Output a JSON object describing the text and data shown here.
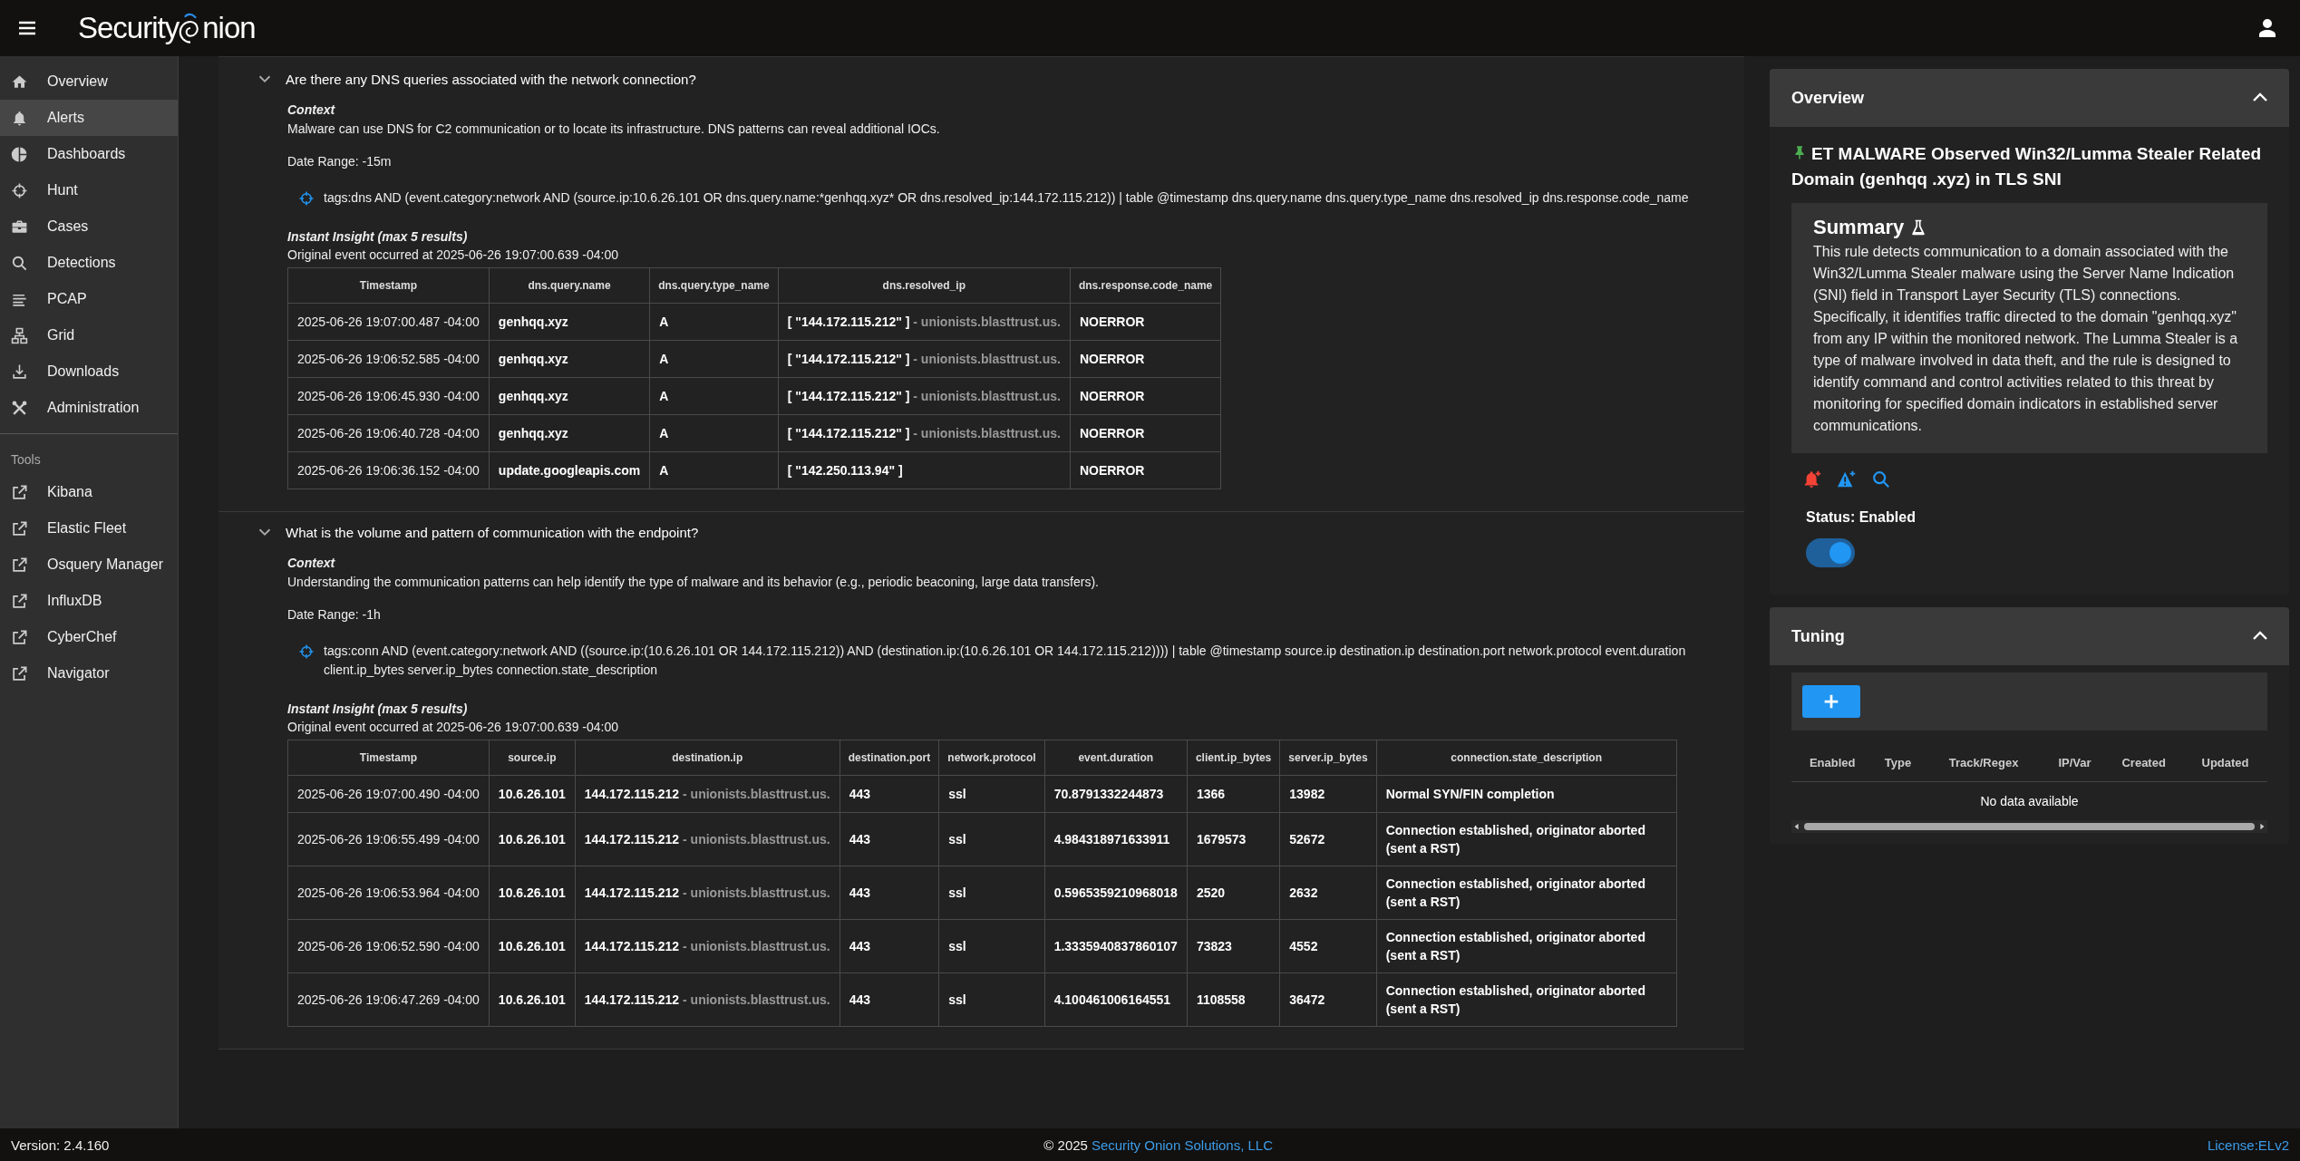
{
  "header": {
    "logo_prefix": "Security",
    "logo_suffix": "nion"
  },
  "sidebar": {
    "items": [
      {
        "label": "Overview",
        "selected": false
      },
      {
        "label": "Alerts",
        "selected": true
      },
      {
        "label": "Dashboards",
        "selected": false
      },
      {
        "label": "Hunt",
        "selected": false
      },
      {
        "label": "Cases",
        "selected": false
      },
      {
        "label": "Detections",
        "selected": false
      },
      {
        "label": "PCAP",
        "selected": false
      },
      {
        "label": "Grid",
        "selected": false
      },
      {
        "label": "Downloads",
        "selected": false
      },
      {
        "label": "Administration",
        "selected": false
      }
    ],
    "tools_heading": "Tools",
    "tools": [
      {
        "label": "Kibana"
      },
      {
        "label": "Elastic Fleet"
      },
      {
        "label": "Osquery Manager"
      },
      {
        "label": "InfluxDB"
      },
      {
        "label": "CyberChef"
      },
      {
        "label": "Navigator"
      }
    ]
  },
  "questions": [
    {
      "question": "Are there any DNS queries associated with the network connection?",
      "expanded": true,
      "context_heading": "Context",
      "context": "Malware can use DNS for C2 communication or to locate its infrastructure. DNS patterns can reveal additional IOCs.",
      "date_range": "Date Range: -15m",
      "query": "tags:dns AND (event.category:network AND (source.ip:10.6.26.101 OR dns.query.name:*genhqq.xyz* OR dns.resolved_ip:144.172.115.212)) | table @timestamp dns.query.name dns.query.type_name dns.resolved_ip dns.response.code_name",
      "insight_heading": "Instant Insight (max 5 results)",
      "original_event": "Original event occurred at 2025-06-26 19:07:00.639 -04:00",
      "table": {
        "columns": [
          "Timestamp",
          "dns.query.name",
          "dns.query.type_name",
          "dns.resolved_ip",
          "dns.response.code_name"
        ],
        "rows": [
          [
            "2025-06-26 19:07:00.487 -04:00",
            "genhqq.xyz",
            "A",
            {
              "text": "[ \"144.172.115.212\" ]",
              "host": "- unionists.blasttrust.us."
            },
            "NOERROR"
          ],
          [
            "2025-06-26 19:06:52.585 -04:00",
            "genhqq.xyz",
            "A",
            {
              "text": "[ \"144.172.115.212\" ]",
              "host": "- unionists.blasttrust.us."
            },
            "NOERROR"
          ],
          [
            "2025-06-26 19:06:45.930 -04:00",
            "genhqq.xyz",
            "A",
            {
              "text": "[ \"144.172.115.212\" ]",
              "host": "- unionists.blasttrust.us."
            },
            "NOERROR"
          ],
          [
            "2025-06-26 19:06:40.728 -04:00",
            "genhqq.xyz",
            "A",
            {
              "text": "[ \"144.172.115.212\" ]",
              "host": "- unionists.blasttrust.us."
            },
            "NOERROR"
          ],
          [
            "2025-06-26 19:06:36.152 -04:00",
            "update.googleapis.com",
            "A",
            {
              "text": "[ \"142.250.113.94\" ]"
            },
            "NOERROR"
          ]
        ]
      }
    },
    {
      "question": "What is the volume and pattern of communication with the endpoint?",
      "expanded": true,
      "context_heading": "Context",
      "context": "Understanding the communication patterns can help identify the type of malware and its behavior (e.g., periodic beaconing, large data transfers).",
      "date_range": "Date Range: -1h",
      "query": "tags:conn AND (event.category:network AND ((source.ip:(10.6.26.101 OR 144.172.115.212)) AND (destination.ip:(10.6.26.101 OR 144.172.115.212)))) | table @timestamp source.ip destination.ip destination.port network.protocol event.duration client.ip_bytes server.ip_bytes connection.state_description",
      "insight_heading": "Instant Insight (max 5 results)",
      "original_event": "Original event occurred at 2025-06-26 19:07:00.639 -04:00",
      "table": {
        "columns": [
          "Timestamp",
          "source.ip",
          "destination.ip",
          "destination.port",
          "network.protocol",
          "event.duration",
          "client.ip_bytes",
          "server.ip_bytes",
          "connection.state_description"
        ],
        "rows": [
          [
            "2025-06-26 19:07:00.490 -04:00",
            "10.6.26.101",
            {
              "text": "144.172.115.212",
              "host": "- unionists.blasttrust.us."
            },
            "443",
            "ssl",
            "70.8791332244873",
            "1366",
            "13982",
            "Normal SYN/FIN completion"
          ],
          [
            "2025-06-26 19:06:55.499 -04:00",
            "10.6.26.101",
            {
              "text": "144.172.115.212",
              "host": "- unionists.blasttrust.us."
            },
            "443",
            "ssl",
            "4.984318971633911",
            "1679573",
            "52672",
            "Connection established, originator aborted (sent a RST)"
          ],
          [
            "2025-06-26 19:06:53.964 -04:00",
            "10.6.26.101",
            {
              "text": "144.172.115.212",
              "host": "- unionists.blasttrust.us."
            },
            "443",
            "ssl",
            "0.5965359210968018",
            "2520",
            "2632",
            "Connection established, originator aborted (sent a RST)"
          ],
          [
            "2025-06-26 19:06:52.590 -04:00",
            "10.6.26.101",
            {
              "text": "144.172.115.212",
              "host": "- unionists.blasttrust.us."
            },
            "443",
            "ssl",
            "1.3335940837860107",
            "73823",
            "4552",
            "Connection established, originator aborted (sent a RST)"
          ],
          [
            "2025-06-26 19:06:47.269 -04:00",
            "10.6.26.101",
            {
              "text": "144.172.115.212",
              "host": "- unionists.blasttrust.us."
            },
            "443",
            "ssl",
            "4.100461006164551",
            "1108558",
            "36472",
            "Connection established, originator aborted (sent a RST)"
          ]
        ]
      }
    }
  ],
  "overview": {
    "title": "Overview",
    "expanded": true,
    "rule": "ET MALWARE Observed Win32/Lumma Stealer Related Domain (genhqq .xyz) in TLS SNI",
    "summary_heading": "Summary",
    "summary": "This rule detects communication to a domain associated with the Win32/Lumma Stealer malware using the Server Name Indication (SNI) field in Transport Layer Security (TLS) connections. Specifically, it identifies traffic directed to the domain \"genhqq.xyz\" from any IP within the monitored network. The Lumma Stealer is a type of malware involved in data theft, and the rule is designed to identify command and control activities related to this threat by monitoring for specified domain indicators in established server communications.",
    "status": "Status: Enabled",
    "enabled": true
  },
  "tuning": {
    "title": "Tuning",
    "expanded": true,
    "columns": [
      "Enabled",
      "Type",
      "Track/Regex",
      "IP/Var",
      "Created",
      "Updated"
    ],
    "empty": "No data available"
  },
  "footer": {
    "version": "Version: 2.4.160",
    "copyright": "© 2025",
    "company": "Security Onion Solutions, LLC",
    "license": "License:ELv2"
  }
}
